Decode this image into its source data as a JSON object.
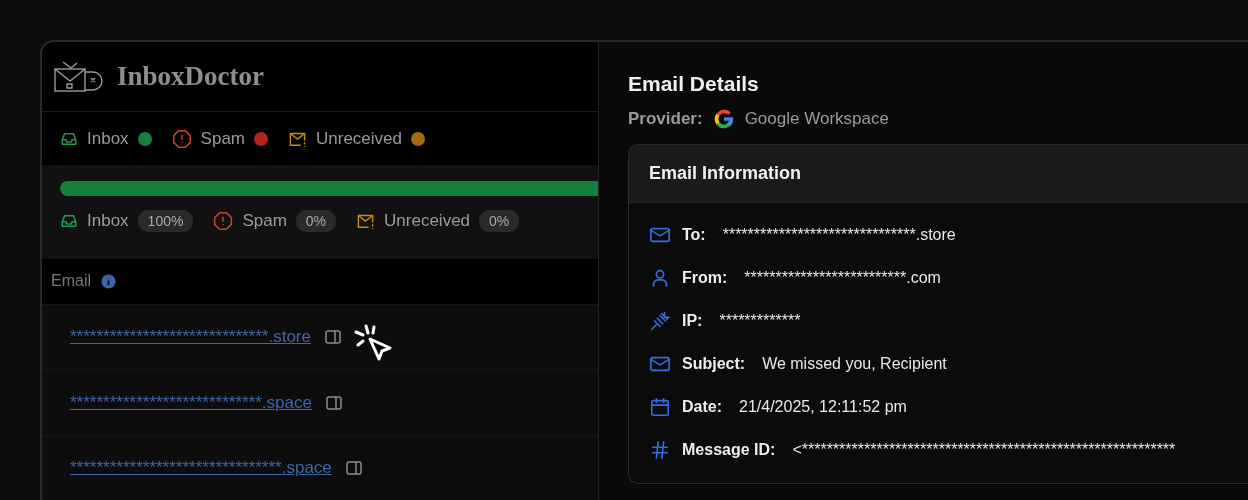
{
  "app": {
    "name": "InboxDoctor"
  },
  "legend": [
    {
      "kind": "inbox",
      "label": "Inbox",
      "color": "#15803d"
    },
    {
      "kind": "spam",
      "label": "Spam",
      "color": "#b42323"
    },
    {
      "kind": "unreceived",
      "label": "Unreceived",
      "color": "#a16a0a"
    }
  ],
  "progress": {
    "level": 1
  },
  "summary": [
    {
      "kind": "inbox",
      "label": "Inbox",
      "share": "100%"
    },
    {
      "kind": "spam",
      "label": "Spam",
      "share": "0%"
    },
    {
      "kind": "unreceived",
      "label": "Unreceived",
      "share": "0%"
    }
  ],
  "table": {
    "columns": [
      "Email"
    ],
    "rows": [
      {
        "email": "******************************.store"
      },
      {
        "email": "*****************************.space"
      },
      {
        "email": "********************************.space"
      }
    ]
  },
  "details": {
    "title": "Email Details",
    "provider_label": "Provider:",
    "provider": "Google Workspace",
    "card_title": "Email Information",
    "fields": [
      {
        "kind": "to",
        "label": "To:",
        "value": "*******************************.store"
      },
      {
        "kind": "from",
        "label": "From:",
        "value": "**************************.com"
      },
      {
        "kind": "ip",
        "label": "IP:",
        "value": "*************"
      },
      {
        "kind": "subject",
        "label": "Subject:",
        "value": "We missed you, Recipient"
      },
      {
        "kind": "date",
        "label": "Date:",
        "value": "21/4/2025, 12:11:52 pm"
      },
      {
        "kind": "message_id",
        "label": "Message ID:",
        "value": "<************************************************************"
      }
    ]
  }
}
